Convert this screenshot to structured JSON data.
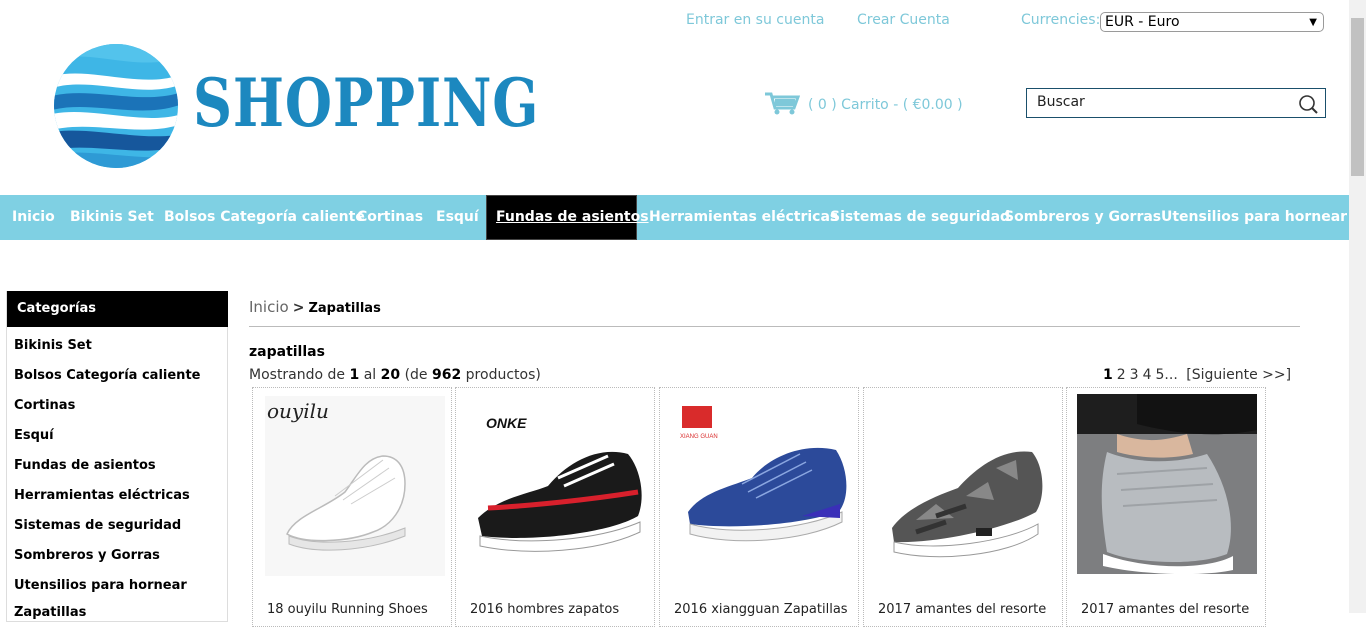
{
  "header": {
    "login_link": "Entrar en su cuenta",
    "register_link": "Crear Cuenta",
    "currency_label": "Currencies:",
    "currency_value": "EUR - Euro",
    "logo_text": "SHOPPING",
    "cart_text": "( 0 ) Carrito - ( €0.00 )",
    "search_placeholder": "Buscar"
  },
  "nav": {
    "items": [
      "Inicio",
      "Bikinis Set",
      "Bolsos Categoría caliente",
      "Cortinas",
      "Esquí",
      "Fundas de asientos",
      "Herramientas eléctricas",
      "Sistemas de seguridad",
      "Sombreros y Gorras",
      "Utensilios para hornear"
    ],
    "active": "Fundas de asientos"
  },
  "sidebar": {
    "heading": "Categorías",
    "items": [
      "Bikinis Set",
      "Bolsos Categoría caliente",
      "Cortinas",
      "Esquí",
      "Fundas de asientos",
      "Herramientas eléctricas",
      "Sistemas de seguridad",
      "Sombreros y Gorras",
      "Utensilios para hornear",
      "Zapatillas"
    ]
  },
  "main": {
    "breadcrumb_home": "Inicio",
    "breadcrumb_sep": ">",
    "breadcrumb_current": "Zapatillas",
    "category_title": "zapatillas",
    "showing_prefix": "Mostrando de",
    "showing_from": "1",
    "showing_to_word": "al",
    "showing_to": "20",
    "showing_of_open": "(de",
    "showing_total": "962",
    "showing_suffix": "productos)",
    "pager": {
      "current": "1",
      "pages": [
        "2",
        "3",
        "4",
        "5..."
      ],
      "next": "[Siguiente >>]"
    }
  },
  "products": [
    {
      "name": "18 ouyilu Running Shoes",
      "brand": "ouyilu"
    },
    {
      "name": "2016 hombres zapatos",
      "brand": "ONKE"
    },
    {
      "name": "2016 xiangguan Zapatillas",
      "brand": "XIANG GUAN"
    },
    {
      "name": "2017 amantes del resorte",
      "brand": ""
    },
    {
      "name": "2017 amantes del resorte",
      "brand": ""
    }
  ],
  "colors": {
    "accent": "#7fd0e3",
    "link": "#7ec8d9",
    "logo": "#1c88bf",
    "active_nav": "#000000"
  }
}
